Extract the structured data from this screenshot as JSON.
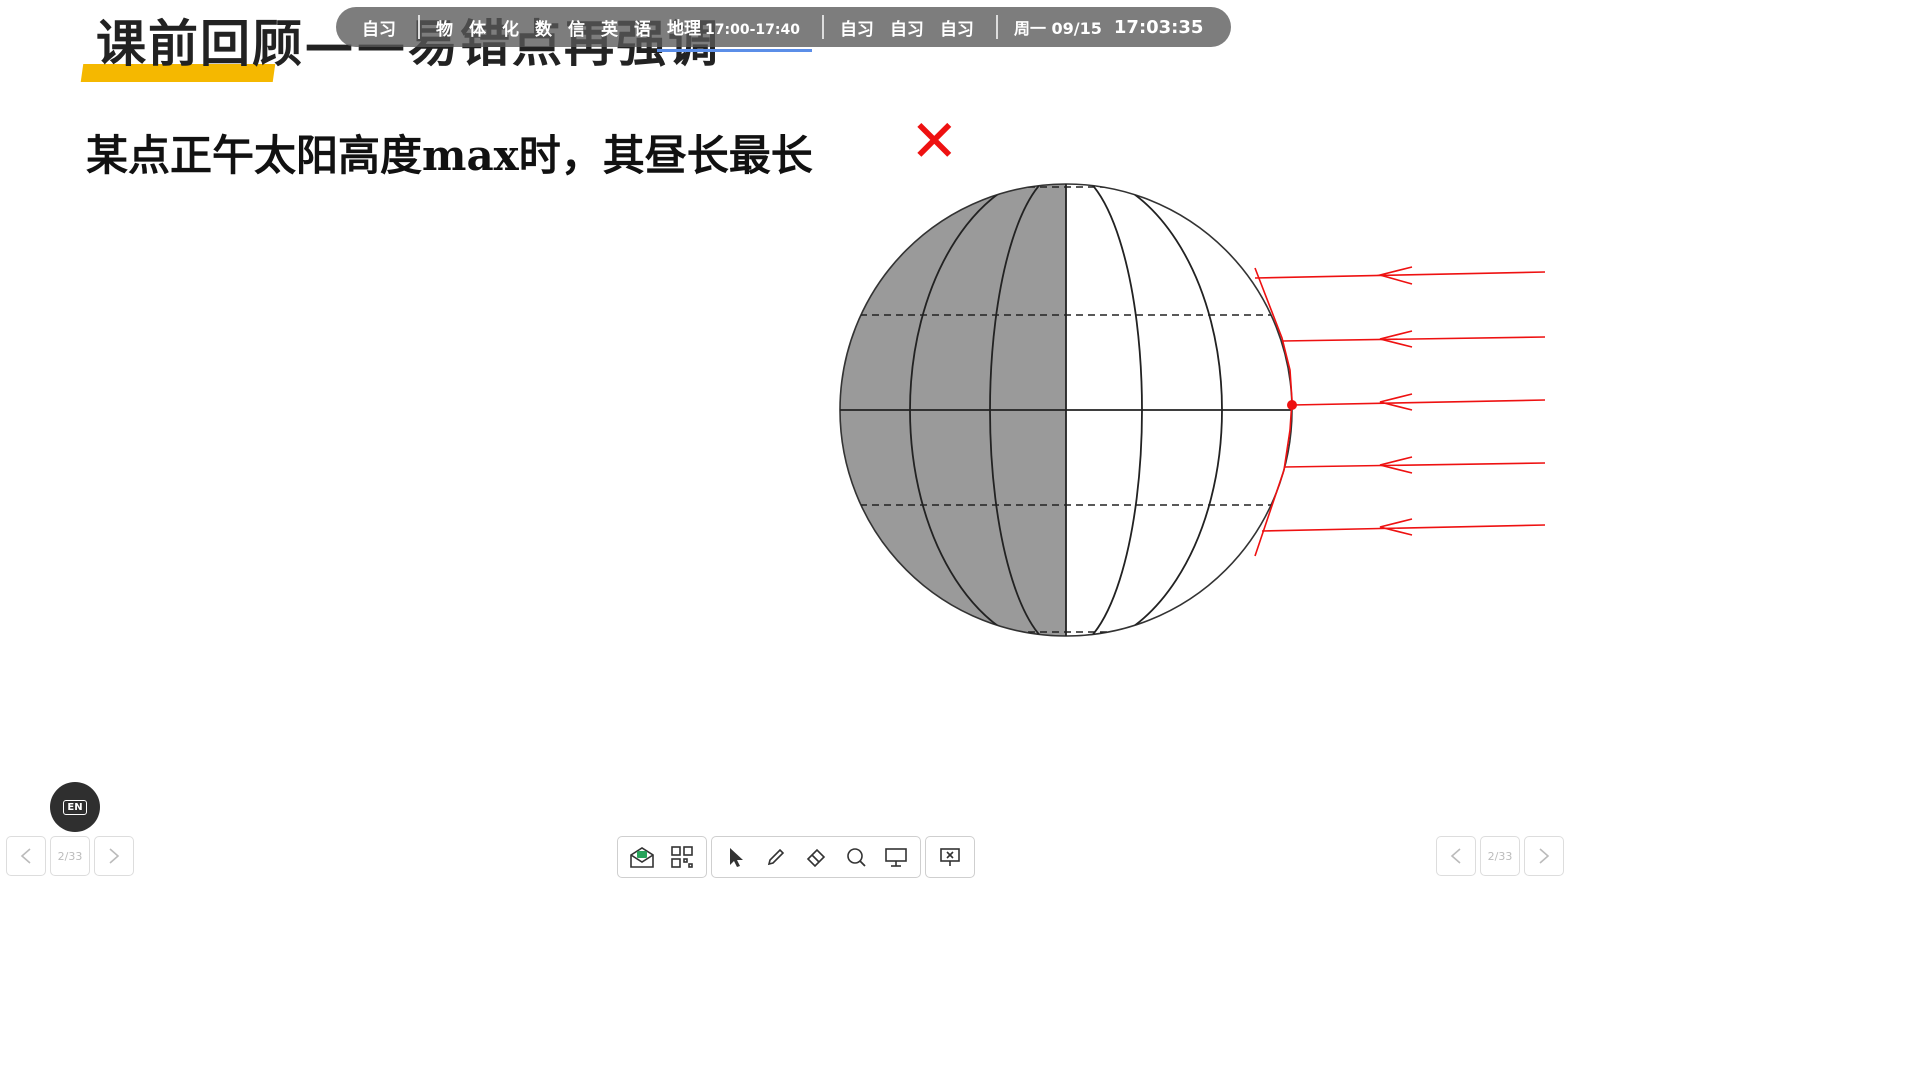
{
  "slide": {
    "title": "课前回顾——易错点再强调",
    "statement": "某点正午太阳高度max时，其昼长最长",
    "verdict_mark": "✕"
  },
  "schedule_bar": {
    "items_before": [
      "自习"
    ],
    "subjects": [
      "物",
      "体",
      "化",
      "数",
      "信",
      "英",
      "语"
    ],
    "current": {
      "subject": "地理",
      "time": "17:00-17:40"
    },
    "items_after": [
      "自习",
      "自习",
      "自习"
    ],
    "date": "周一 09/15",
    "clock": "17:03:35"
  },
  "language_button": {
    "label": "EN"
  },
  "pager_left": {
    "page": "2/33"
  },
  "pager_right": {
    "page": "2/33"
  },
  "toolbar": {
    "tools": [
      "envelope-icon",
      "qr-code-icon",
      "select-cursor-icon",
      "pen-icon",
      "eraser-icon",
      "search-icon",
      "screen-icon",
      "close-presentation-icon"
    ]
  },
  "colors": {
    "title_highlight": "#f5b800",
    "wrong_mark": "#ee1111",
    "night_side": "#9a9a9a",
    "sun_rays": "#ee1111",
    "progress": "#5b8ee8"
  }
}
